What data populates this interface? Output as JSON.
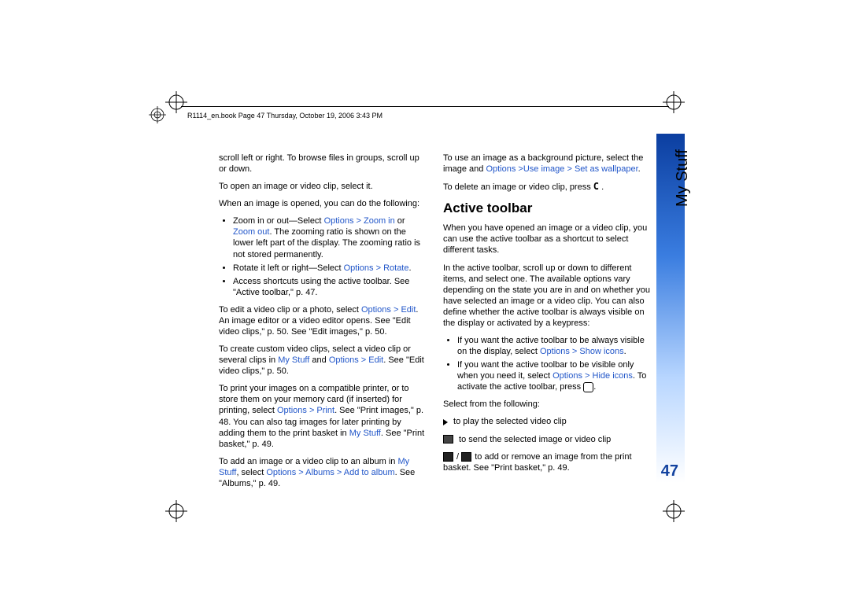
{
  "header": "R1114_en.book  Page 47  Thursday, October 19, 2006  3:43 PM",
  "sidebar_label": "My Stuff",
  "page_number": "47",
  "left": {
    "p1": "scroll left or right. To browse files in groups, scroll up or down.",
    "p2": "To open an image or video clip, select it.",
    "p3": "When an image is opened, you can do the following:",
    "b1a": "Zoom in or out—Select ",
    "b1_link1": "Options > Zoom in",
    "b1_mid": " or ",
    "b1_link2": "Zoom out",
    "b1b": ". The zooming ratio is shown on the lower left part of the display. The zooming ratio is not stored permanently.",
    "b2a": "Rotate it left or right—Select ",
    "b2_link": "Options > Rotate",
    "b2b": ".",
    "b3": "Access shortcuts using the active toolbar. See \"Active toolbar,\" p. 47.",
    "p4a": "To edit a video clip or a photo, select ",
    "p4_link": "Options > Edit",
    "p4b": ". An image editor or a video editor opens. See \"Edit video clips,\" p. 50. See \"Edit images,\" p. 50.",
    "p5a": "To create custom video clips, select a video clip or several clips in ",
    "p5_link1": "My Stuff",
    "p5_mid": " and ",
    "p5_link2": "Options > Edit",
    "p5b": ". See \"Edit video clips,\" p. 50.",
    "p6a": "To print your images on a compatible printer, or to store them on your memory card (if inserted) for printing, select ",
    "p6_link1": "Options > Print",
    "p6_mid": ". See \"Print images,\" p. 48. You can also tag images for later printing by adding them to the print basket in ",
    "p6_link2": "My Stuff",
    "p6b": ". See \"Print basket,\" p. 49.",
    "p7a": "To add an image or a video clip to an album in ",
    "p7_link1": "My Stuff",
    "p7_mid": ", select ",
    "p7_link2": "Options > Albums > Add to album",
    "p7b": ". See \"Albums,\" p. 49."
  },
  "right": {
    "p1a": "To use an image as a background picture, select the image and ",
    "p1_link": "Options >Use image > Set as wallpaper",
    "p1b": ".",
    "p2a": "To delete an image or video clip, press ",
    "p2_key": "C",
    "p2b": " .",
    "heading": "Active toolbar",
    "p3": "When you have opened an image or a video clip, you can use the active toolbar as a shortcut to select different tasks.",
    "p4": "In the active toolbar, scroll up or down to different items, and select one. The available options vary depending on the state you are in and on whether you have selected an image or a video clip. You can also define whether the active toolbar is always visible on the display or activated by a keypress:",
    "b1a": "If you want the active toolbar to be always visible on the display, select ",
    "b1_link": "Options > Show icons",
    "b1b": ".",
    "b2a": "If you want the active toolbar to be visible only when you need it, select ",
    "b2_link": "Options > Hide icons",
    "b2b": ". To activate the active toolbar, press ",
    "b2c": ".",
    "p5": "Select from the following:",
    "i1": " to play the selected video clip",
    "i2": " to send the selected image or video clip",
    "i3": " to add or remove an image from the print basket. See \"Print basket,\" p. 49."
  }
}
